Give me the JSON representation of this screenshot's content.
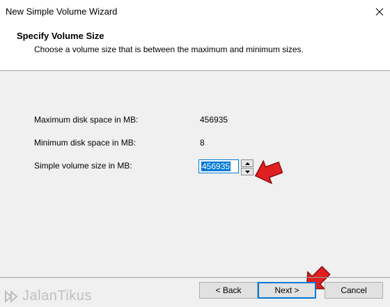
{
  "window": {
    "title": "New Simple Volume Wizard"
  },
  "header": {
    "title": "Specify Volume Size",
    "subtitle": "Choose a volume size that is between the maximum and minimum sizes."
  },
  "fields": {
    "max_label": "Maximum disk space in MB:",
    "max_value": "456935",
    "min_label": "Minimum disk space in MB:",
    "min_value": "8",
    "size_label": "Simple volume size in MB:",
    "size_value": "456935"
  },
  "buttons": {
    "back": "< Back",
    "next": "Next >",
    "cancel": "Cancel"
  },
  "watermark": {
    "text": "JalanTikus"
  },
  "icons": {
    "close": "close-icon",
    "spin_up": "chevron-up-icon",
    "spin_down": "chevron-down-icon",
    "annotation_arrow": "red-arrow-icon",
    "watermark_logo": "jalantikus-logo-icon"
  },
  "colors": {
    "accent": "#0078d7",
    "annotation": "#e02020",
    "header_bg": "#ffffff",
    "body_bg": "#f0f0f0"
  }
}
